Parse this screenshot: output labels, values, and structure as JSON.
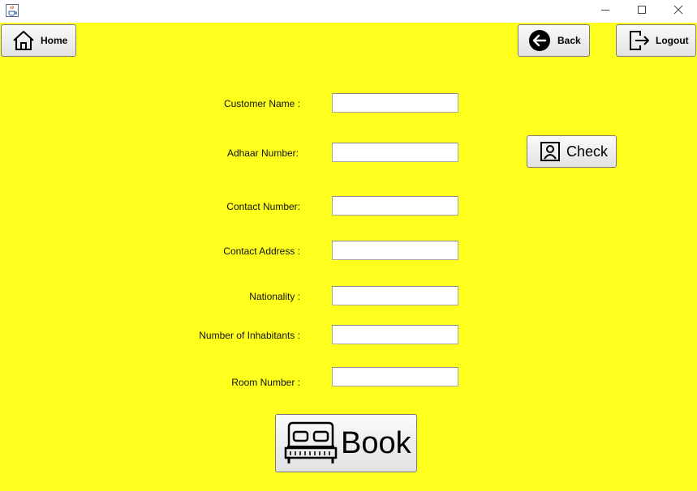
{
  "window": {
    "icon": "java-cup-icon",
    "controls": [
      "minimize-icon",
      "maximize-icon",
      "close-icon"
    ]
  },
  "nav": {
    "home_label": "Home",
    "back_label": "Back",
    "logout_label": "Logout"
  },
  "form": {
    "fields": [
      {
        "label": "Customer Name :",
        "value": ""
      },
      {
        "label": "Adhaar Number:",
        "value": ""
      },
      {
        "label": "Contact Number:",
        "value": ""
      },
      {
        "label": "Contact Address :",
        "value": ""
      },
      {
        "label": "Nationality :",
        "value": ""
      },
      {
        "label": "Number of Inhabitants :",
        "value": ""
      },
      {
        "label": "Room Number :",
        "value": ""
      }
    ],
    "check_label": "Check",
    "book_label": "Book"
  },
  "colors": {
    "background": "#ffff1e",
    "button_bg": "#ececec"
  }
}
